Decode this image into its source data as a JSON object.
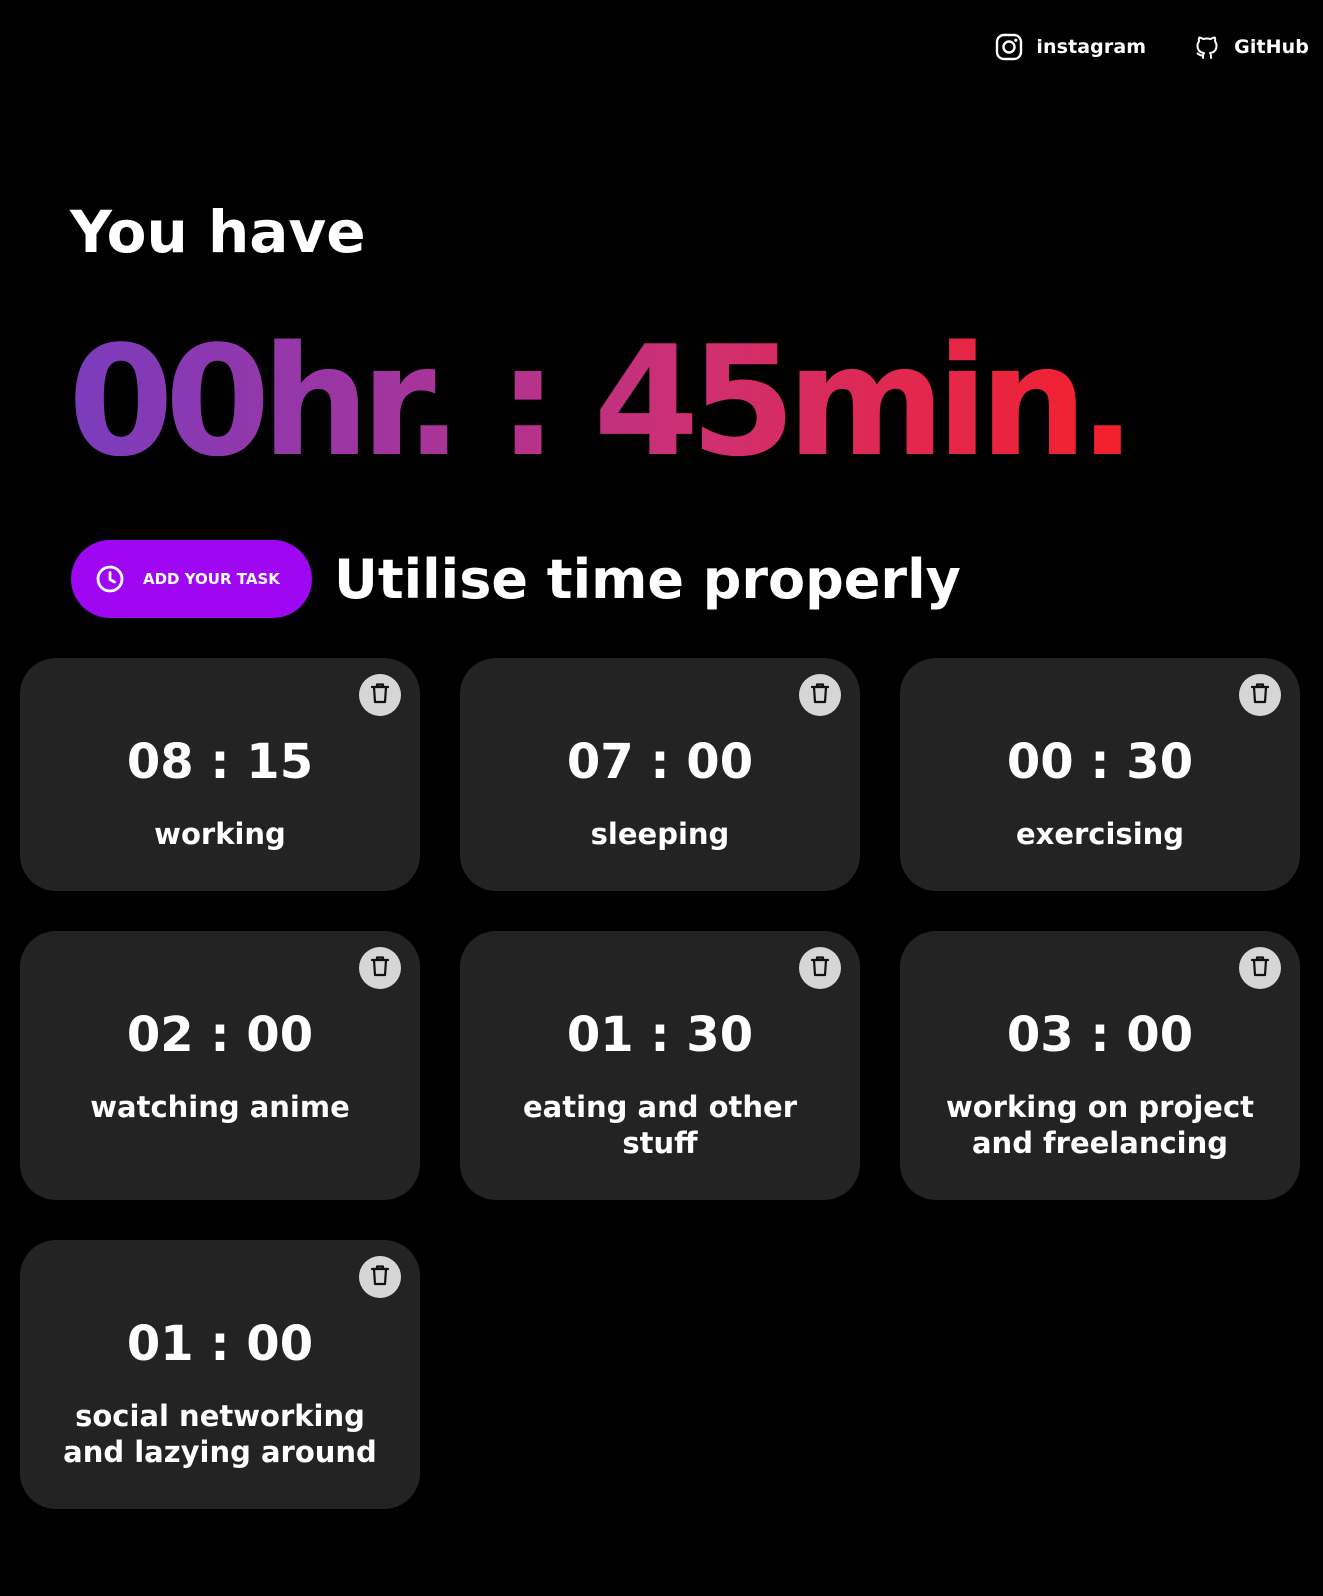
{
  "nav": {
    "instagram": {
      "label": "instagram",
      "icon": "instagram-icon"
    },
    "github": {
      "label": "GitHub",
      "icon": "github-icon"
    }
  },
  "hero": {
    "heading": "You have",
    "remaining": "00hr. : 45min.",
    "gradient_colors": [
      "#7a3cbd",
      "#a1359f",
      "#cf2f70",
      "#f5202b"
    ]
  },
  "add_button": {
    "label": "ADD YOUR TASK",
    "icon": "clock-icon",
    "color": "#9f07f2"
  },
  "tagline": "Utilise time properly",
  "tasks": [
    {
      "time": "08 : 15",
      "label": "working"
    },
    {
      "time": "07 : 00",
      "label": "sleeping"
    },
    {
      "time": "00 : 30",
      "label": "exercising"
    },
    {
      "time": "02 : 00",
      "label": "watching anime"
    },
    {
      "time": "01 : 30",
      "label": "eating and other stuff"
    },
    {
      "time": "03 : 00",
      "label": "working on project and freelancing"
    },
    {
      "time": "01 : 00",
      "label": "social networking and lazying around"
    }
  ],
  "card_color": "#232323",
  "delete_icon": "trash-icon"
}
